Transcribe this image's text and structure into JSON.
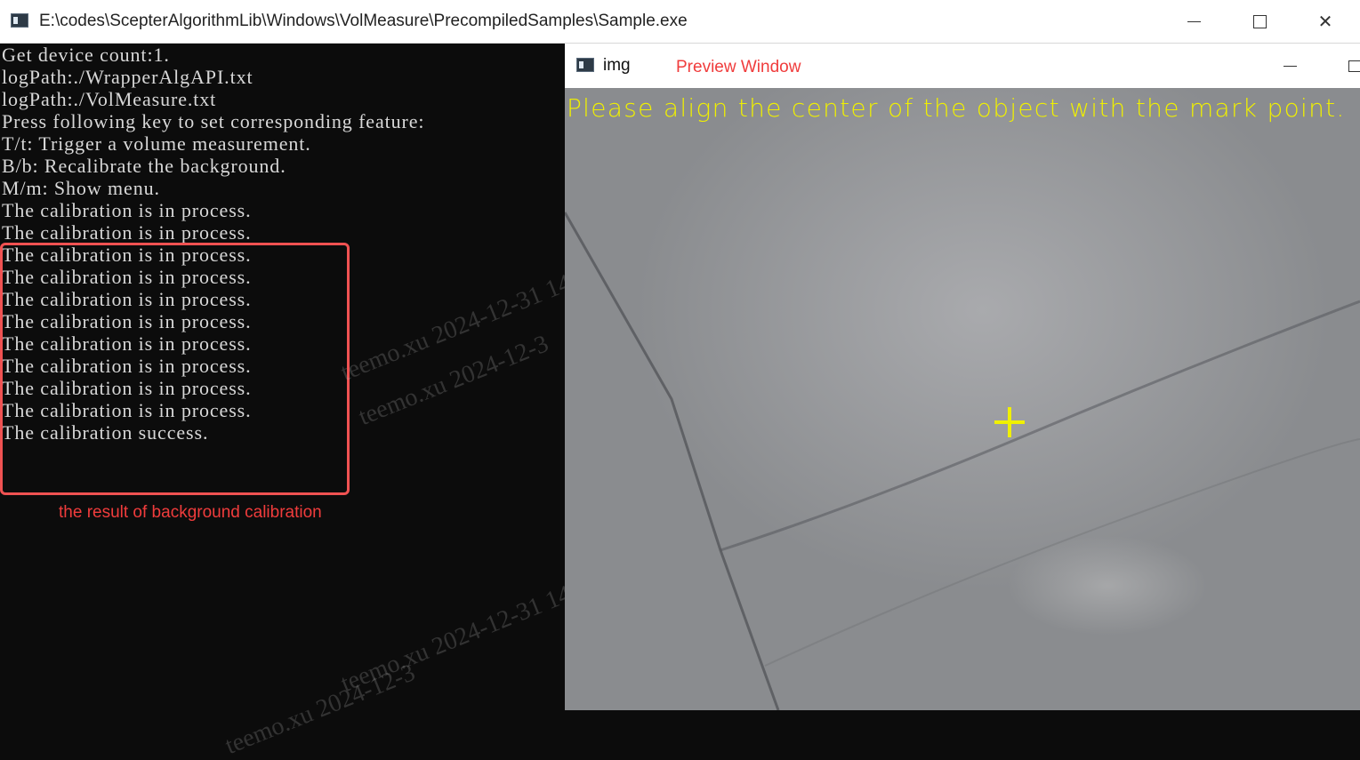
{
  "console_window": {
    "title": "E:\\codes\\ScepterAlgorithmLib\\Windows\\VolMeasure\\PrecompiledSamples\\Sample.exe",
    "controls": {
      "minimize": "minimize",
      "maximize": "maximize",
      "close": "✕"
    },
    "lines": [
      "Get device count:1.",
      "logPath:./WrapperAlgAPI.txt",
      "logPath:./VolMeasure.txt",
      "Press following key to set corresponding feature:",
      "T/t: Trigger a volume measurement.",
      "B/b: Recalibrate the background.",
      "M/m: Show menu.",
      "The calibration is in process.",
      "The calibration is in process.",
      "The calibration is in process.",
      "The calibration is in process.",
      "The calibration is in process.",
      "The calibration is in process.",
      "The calibration is in process.",
      "The calibration is in process.",
      "The calibration is in process.",
      "The calibration is in process.",
      "The calibration success."
    ],
    "annotation": "the result of background calibration",
    "watermark": [
      "teemo.xu 2024-12-31 14:",
      "teemo.xu 2024-12-3"
    ]
  },
  "preview_window": {
    "title": "img",
    "annotation": "Preview Window",
    "overlay_text": "Please align the center of the object with the mark point.",
    "mark_color": "#f0f000"
  },
  "colors": {
    "console_bg": "#0c0c0c",
    "console_text": "#d8d8d8",
    "annotation": "#f03c3c",
    "overlay_text": "#f0f000"
  }
}
